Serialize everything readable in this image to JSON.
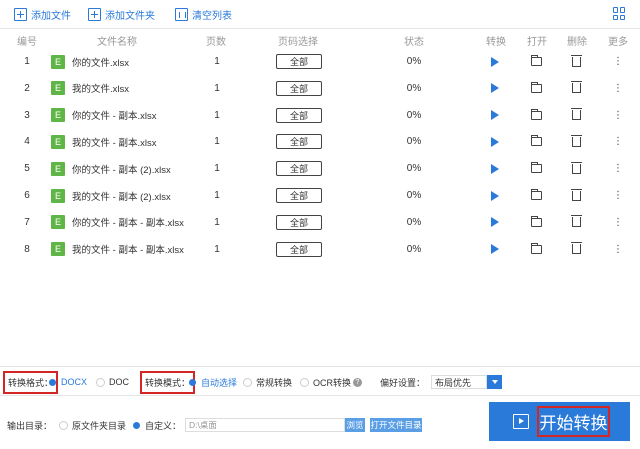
{
  "toolbar": {
    "add_file": "添加文件",
    "add_folder": "添加文件夹",
    "clear_list": "清空列表"
  },
  "table": {
    "headers": {
      "num": "编号",
      "name": "文件名称",
      "pages": "页数",
      "range": "页码选择",
      "status": "状态",
      "convert": "转换",
      "open": "打开",
      "delete": "删除",
      "more": "更多"
    },
    "rows": [
      {
        "num": "1",
        "icon": "E",
        "name": "你的文件.xlsx",
        "pages": "1",
        "range": "全部",
        "status": "0%"
      },
      {
        "num": "2",
        "icon": "E",
        "name": "我的文件.xlsx",
        "pages": "1",
        "range": "全部",
        "status": "0%"
      },
      {
        "num": "3",
        "icon": "E",
        "name": "你的文件 - 副本.xlsx",
        "pages": "1",
        "range": "全部",
        "status": "0%"
      },
      {
        "num": "4",
        "icon": "E",
        "name": "我的文件 - 副本.xlsx",
        "pages": "1",
        "range": "全部",
        "status": "0%"
      },
      {
        "num": "5",
        "icon": "E",
        "name": "你的文件 - 副本 (2).xlsx",
        "pages": "1",
        "range": "全部",
        "status": "0%"
      },
      {
        "num": "6",
        "icon": "E",
        "name": "我的文件 - 副本 (2).xlsx",
        "pages": "1",
        "range": "全部",
        "status": "0%"
      },
      {
        "num": "7",
        "icon": "E",
        "name": "你的文件 - 副本 - 副本.xlsx",
        "pages": "1",
        "range": "全部",
        "status": "0%"
      },
      {
        "num": "8",
        "icon": "E",
        "name": "我的文件 - 副本 - 副本.xlsx",
        "pages": "1",
        "range": "全部",
        "status": "0%"
      }
    ]
  },
  "format": {
    "label": "转换格式：",
    "options": [
      "DOCX",
      "DOC"
    ],
    "selected": "DOCX"
  },
  "mode": {
    "label": "转换模式：",
    "options": [
      "自动选择",
      "常规转换",
      "OCR转换"
    ],
    "selected": "自动选择",
    "help": "?"
  },
  "preference": {
    "label": "偏好设置：",
    "value": "布局优先"
  },
  "output": {
    "label": "输出目录：",
    "options": [
      "原文件夹目录",
      "自定义："
    ],
    "selected": "自定义：",
    "path_placeholder": "D:\\桌面",
    "browse": "浏览",
    "open_dir": "打开文件目录"
  },
  "start_button": "开始转换",
  "colors": {
    "accent": "#2a7ad9",
    "excel_green": "#5fb646",
    "highlight_red": "#d52626"
  }
}
